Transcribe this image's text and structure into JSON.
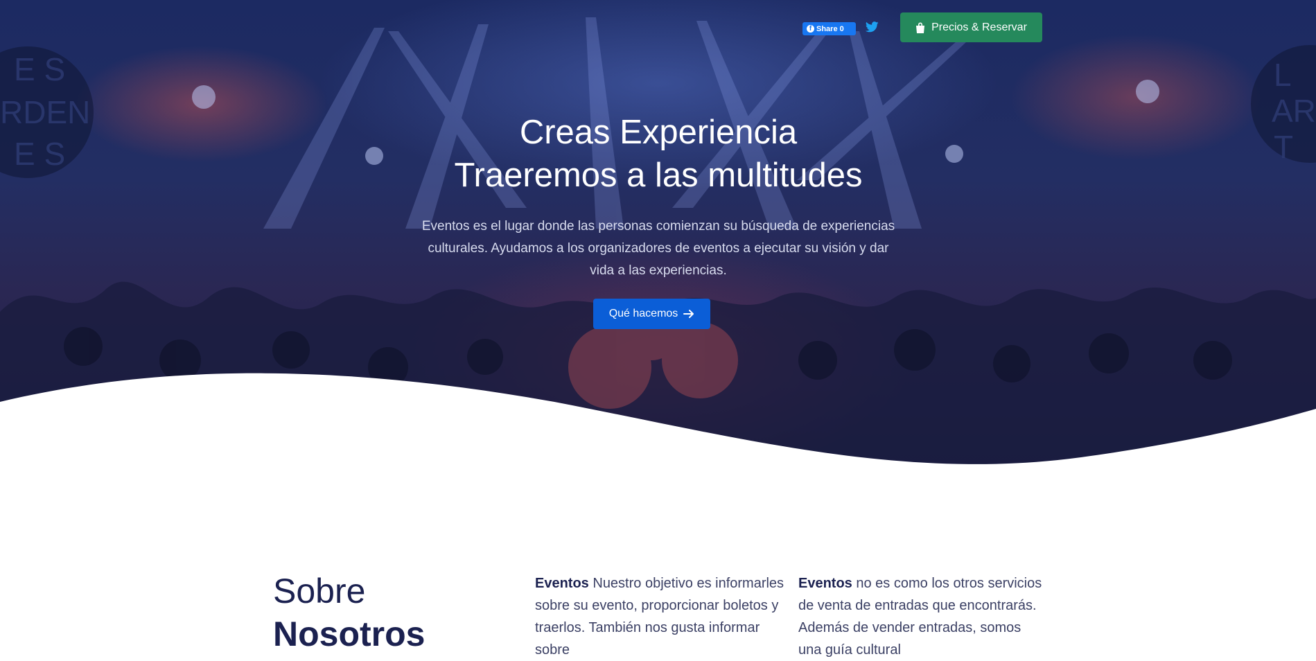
{
  "header": {
    "share": {
      "label": "Share",
      "count": "0",
      "icon": "facebook-icon"
    },
    "twitter": {
      "icon": "twitter-icon"
    },
    "reserve_button": {
      "label": "Precios & Reservar",
      "icon": "shopping-bag-icon"
    }
  },
  "hero": {
    "title_line1": "Creas Experiencia",
    "title_line2": "Traeremos a las multitudes",
    "description": "Eventos es el lugar donde las personas comienzan su búsqueda de experiencias culturales. Ayudamos a los organizadores de eventos a ejecutar su visión y dar vida a las experiencias.",
    "cta_label": "Qué hacemos",
    "cta_icon": "arrow-right-icon"
  },
  "about": {
    "heading_light": "Sobre",
    "heading_bold": "Nosotros",
    "col1_strong": "Eventos",
    "col1_text": " Nuestro objetivo es informarles sobre su evento, proporcionar boletos y traerlos. También nos gusta informar sobre",
    "col2_strong": "Eventos",
    "col2_text": " no es como los otros servicios de venta de entradas que encontrarás. Además de vender entradas, somos una guía cultural"
  },
  "colors": {
    "hero_overlay": "#1c2a62",
    "primary": "#0b5ed7",
    "reserve_green": "#25895c",
    "facebook_blue": "#1877f2",
    "twitter_blue": "#1da1f2",
    "heading_navy": "#1b2150"
  }
}
